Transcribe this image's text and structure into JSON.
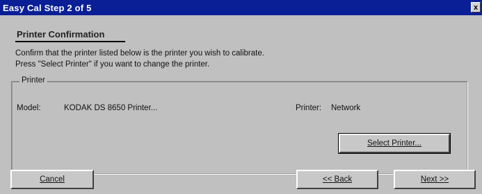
{
  "window": {
    "title": "Easy Cal Step 2 of 5",
    "close_glyph": "x"
  },
  "page": {
    "heading": "Printer Confirmation",
    "line1": "Confirm that the printer listed below is the printer you wish to calibrate.",
    "line2": "Press \"Select Printer\" if you want to change the printer."
  },
  "group": {
    "label": "Printer",
    "model_label": "Model:",
    "model_value": "KODAK DS 8650 Printer...",
    "printer_label": "Printer:",
    "printer_value": "Network"
  },
  "buttons": {
    "select_printer": "Select Printer...",
    "cancel": "Cancel",
    "back": "<< Back",
    "next": "Next >>"
  },
  "colors": {
    "titlebar": "#0a1e96",
    "face": "#c0c0c0"
  }
}
